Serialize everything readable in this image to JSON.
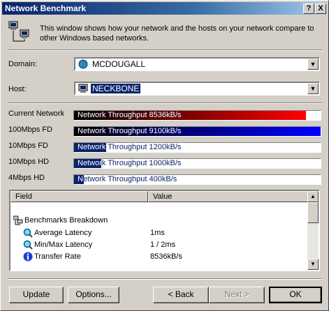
{
  "window": {
    "title": "Network Benchmark",
    "help_label": "?",
    "close_label": "X"
  },
  "intro": {
    "text": "This window shows how your network and the hosts on your network compare to other Windows based networks."
  },
  "domain": {
    "label": "Domain:",
    "value": "MCDOUGALL",
    "icon": "globe-icon"
  },
  "host": {
    "label": "Host:",
    "value": "NECKBONE",
    "icon": "computer-icon"
  },
  "benchmarks": [
    {
      "name": "Current Network",
      "text": "Network Throughput 8536kB/s",
      "fraction": 0.94,
      "color": "#ff0000"
    },
    {
      "name": "100Mbps FD",
      "text": "Network Throughput 9100kB/s",
      "fraction": 1.0,
      "color": "#0000ff"
    },
    {
      "name": "10Mbps FD",
      "text": "Network Throughput 1200kB/s",
      "fraction": 0.13,
      "color": "#0a246a"
    },
    {
      "name": "10Mbps HD",
      "text": "Network Throughput 1000kB/s",
      "fraction": 0.11,
      "color": "#0a246a"
    },
    {
      "name": "4Mbps HD",
      "text": "Network Throughput 400kB/s",
      "fraction": 0.04,
      "color": "#0a246a"
    }
  ],
  "details": {
    "columns": [
      "Field",
      "Value"
    ],
    "group": "Benchmarks Breakdown",
    "rows": [
      {
        "field": "Average Latency",
        "value": "1ms",
        "icon": "magnifier-icon"
      },
      {
        "field": "Min/Max Latency",
        "value": "1 / 2ms",
        "icon": "magnifier-icon"
      },
      {
        "field": "Transfer Rate",
        "value": "8536kB/s",
        "icon": "info-icon"
      }
    ]
  },
  "buttons": {
    "update": "Update",
    "options": "Options...",
    "back": "< Back",
    "next": "Next >",
    "ok": "OK"
  }
}
